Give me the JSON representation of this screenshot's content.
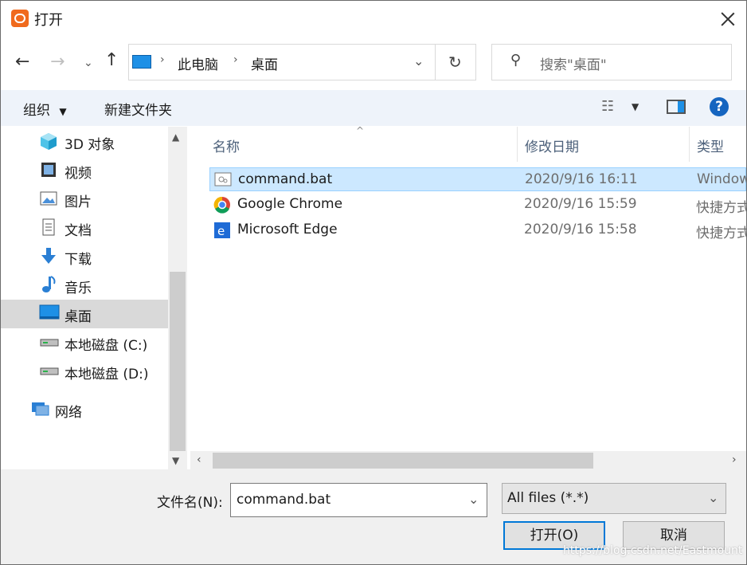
{
  "window": {
    "title": "打开"
  },
  "nav": {
    "breadcrumb": [
      "此电脑",
      "桌面"
    ],
    "search_placeholder": "搜索\"桌面\""
  },
  "toolbar": {
    "organize_label": "组织",
    "new_folder_label": "新建文件夹"
  },
  "sidebar": {
    "items": [
      {
        "label": "3D 对象",
        "icon": "cube-icon"
      },
      {
        "label": "视频",
        "icon": "video-icon"
      },
      {
        "label": "图片",
        "icon": "picture-icon"
      },
      {
        "label": "文档",
        "icon": "document-icon"
      },
      {
        "label": "下载",
        "icon": "download-icon"
      },
      {
        "label": "音乐",
        "icon": "music-icon"
      },
      {
        "label": "桌面",
        "icon": "desktop-icon",
        "selected": true
      },
      {
        "label": "本地磁盘 (C:)",
        "icon": "drive-icon"
      },
      {
        "label": "本地磁盘 (D:)",
        "icon": "drive-icon"
      },
      {
        "label": "网络",
        "icon": "network-icon"
      }
    ]
  },
  "file_list": {
    "columns": [
      "名称",
      "修改日期",
      "类型"
    ],
    "rows": [
      {
        "name": "command.bat",
        "date": "2020/9/16 16:11",
        "type": "Window",
        "icon": "batch-file-icon",
        "selected": true
      },
      {
        "name": "Google Chrome",
        "date": "2020/9/16 15:59",
        "type": "快捷方式",
        "icon": "chrome-icon"
      },
      {
        "name": "Microsoft Edge",
        "date": "2020/9/16 15:58",
        "type": "快捷方式",
        "icon": "edge-icon"
      }
    ]
  },
  "footer": {
    "filename_label": "文件名(N):",
    "filename_value": "command.bat",
    "filter_value": "All files (*.*)",
    "open_label": "打开(O)",
    "cancel_label": "取消"
  },
  "watermark": "https://blog.csdn.net/Eastmount",
  "colors": {
    "accent": "#0078d7",
    "selection": "#cce8ff",
    "toolbar_bg": "#eef3fa"
  }
}
